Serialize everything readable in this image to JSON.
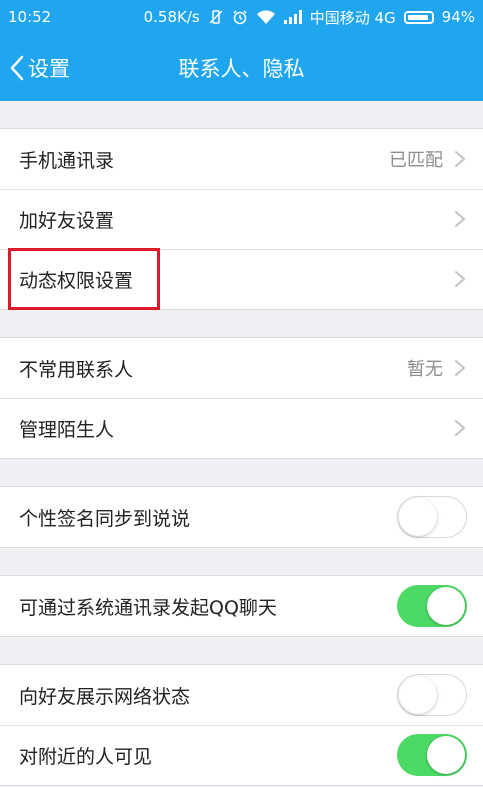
{
  "status_bar": {
    "time": "10:52",
    "speed": "0.58K/s",
    "carrier": "中国移动 4G",
    "battery": "94%",
    "battery_level": 0.94
  },
  "nav": {
    "back_label": "设置",
    "title": "联系人、隐私"
  },
  "groups": [
    {
      "rows": [
        {
          "label": "手机通讯录",
          "value": "已匹配",
          "type": "link"
        },
        {
          "label": "加好友设置",
          "value": "",
          "type": "link"
        },
        {
          "label": "动态权限设置",
          "value": "",
          "type": "link",
          "highlighted": true
        }
      ]
    },
    {
      "rows": [
        {
          "label": "不常用联系人",
          "value": "暂无",
          "type": "link"
        },
        {
          "label": "管理陌生人",
          "value": "",
          "type": "link"
        }
      ]
    },
    {
      "rows": [
        {
          "label": "个性签名同步到说说",
          "type": "toggle",
          "on": false
        }
      ]
    },
    {
      "rows": [
        {
          "label": "可通过系统通讯录发起QQ聊天",
          "type": "toggle",
          "on": true
        }
      ]
    },
    {
      "rows": [
        {
          "label": "向好友展示网络状态",
          "type": "toggle",
          "on": false
        },
        {
          "label": "对附近的人可见",
          "type": "toggle",
          "on": true
        }
      ]
    }
  ],
  "colors": {
    "header": "#1fa6ee",
    "toggle_on": "#4cd964",
    "highlight": "#e11a2b",
    "background": "#efeff4"
  }
}
